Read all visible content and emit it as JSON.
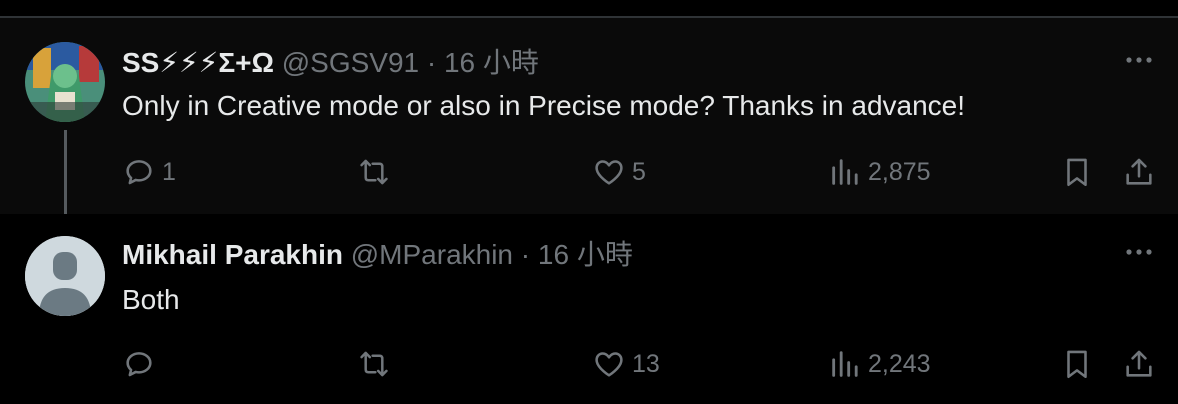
{
  "tweets": [
    {
      "name": "SS⚡⚡⚡Σ+Ω",
      "handle": "@SGSV91",
      "separator": "·",
      "time": "16 小時",
      "text": "Only in Creative mode or also in Precise mode? Thanks in advance!",
      "replies": "1",
      "retweets": "",
      "likes": "5",
      "views": "2,875"
    },
    {
      "name": "Mikhail Parakhin",
      "handle": "@MParakhin",
      "separator": "·",
      "time": "16 小時",
      "text": "Both",
      "replies": "",
      "retweets": "",
      "likes": "13",
      "views": "2,243"
    }
  ],
  "icons": {
    "reply": "reply-icon",
    "retweet": "retweet-icon",
    "like": "heart-icon",
    "views": "views-icon",
    "bookmark": "bookmark-icon",
    "share": "share-icon",
    "more": "more-icon"
  },
  "colors": {
    "background": "#000000",
    "text": "#e7e9ea",
    "muted": "#71767b",
    "default_avatar": "#cfd9de"
  }
}
